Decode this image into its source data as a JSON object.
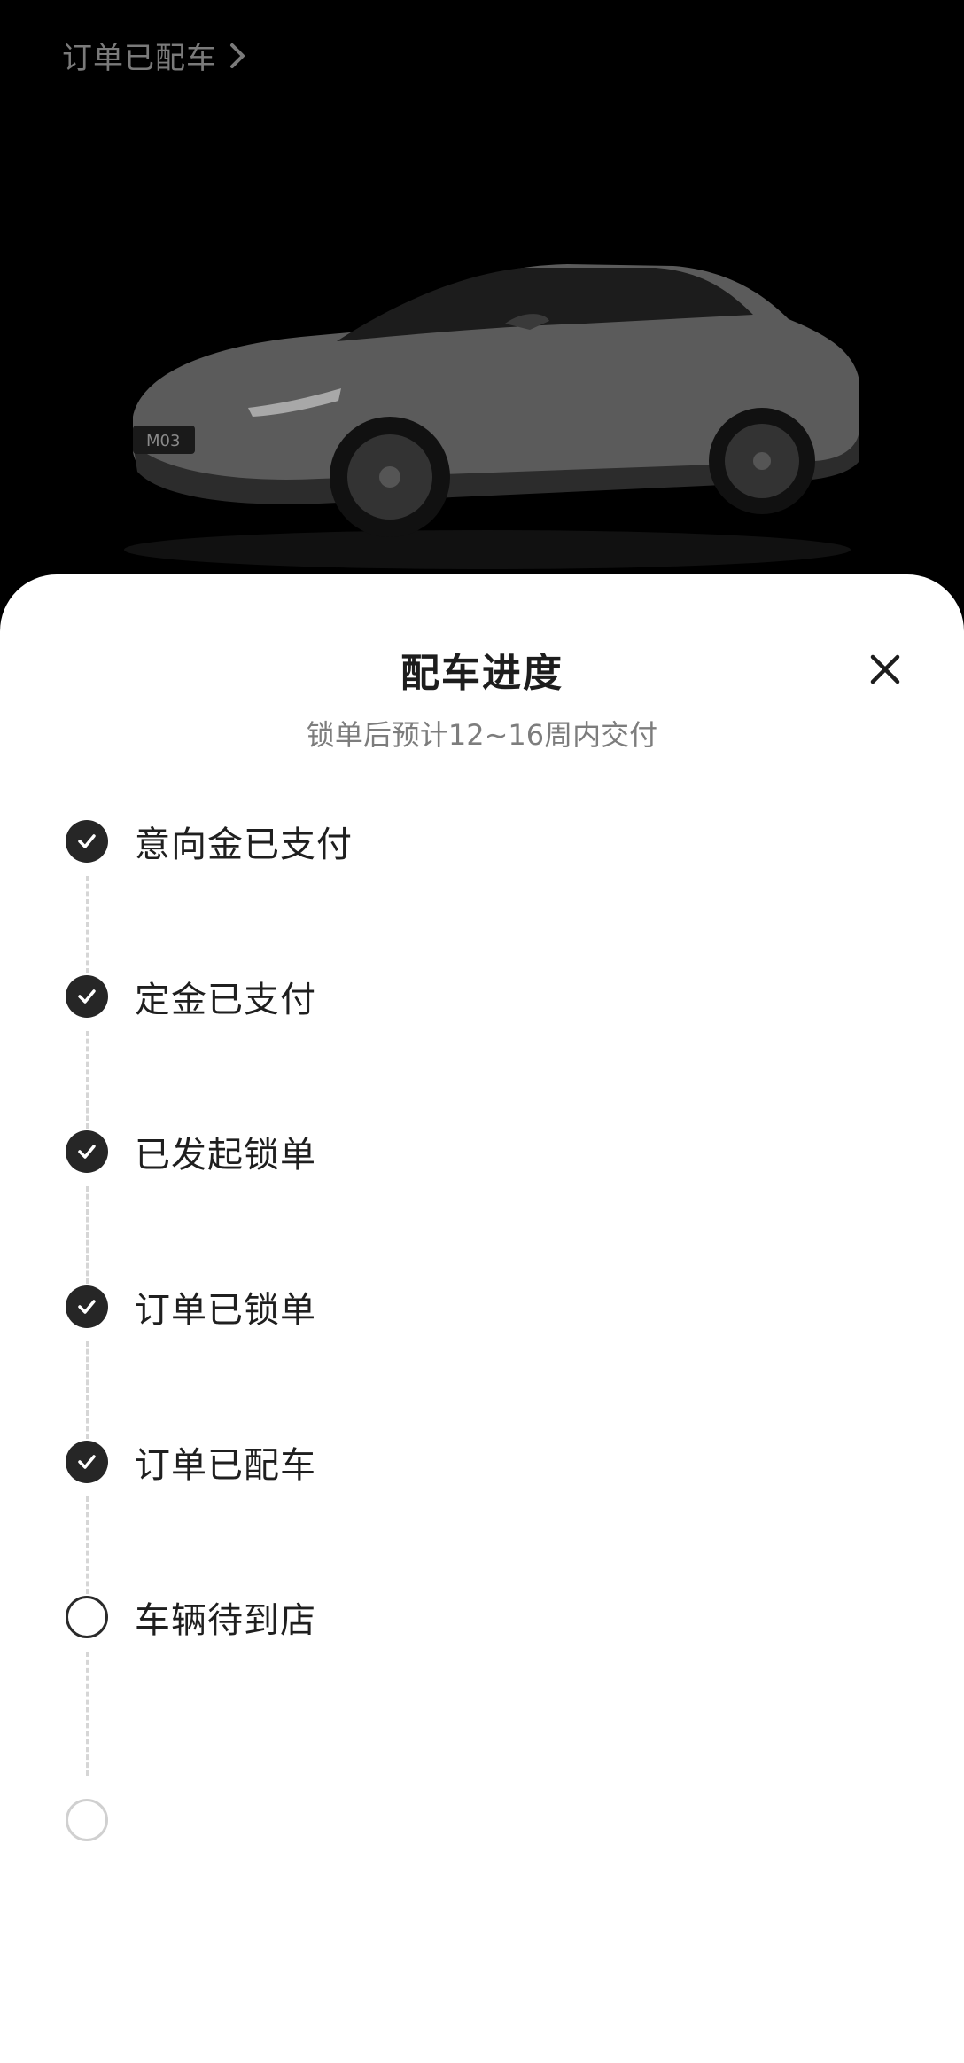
{
  "header": {
    "breadcrumb": "订单已配车"
  },
  "hero": {
    "plate_text": "M03"
  },
  "sheet": {
    "title": "配车进度",
    "subtitle": "锁单后预计12~16周内交付",
    "steps": [
      {
        "label": "意向金已支付",
        "status": "done"
      },
      {
        "label": "定金已支付",
        "status": "done"
      },
      {
        "label": "已发起锁单",
        "status": "done"
      },
      {
        "label": "订单已锁单",
        "status": "done"
      },
      {
        "label": "订单已配车",
        "status": "done"
      },
      {
        "label": "车辆待到店",
        "status": "pending"
      },
      {
        "label": "",
        "status": "future"
      }
    ]
  },
  "icons": {
    "breadcrumb": "chevron-right-icon",
    "close": "close-icon",
    "done": "check-circle-icon",
    "pending": "empty-circle-icon"
  },
  "colors": {
    "sheet_background": "#ffffff",
    "done_dot": "#262626",
    "connector": "#d6d6d6",
    "title_text": "#1d1d1d",
    "subtitle_text": "#7d7d7d"
  }
}
